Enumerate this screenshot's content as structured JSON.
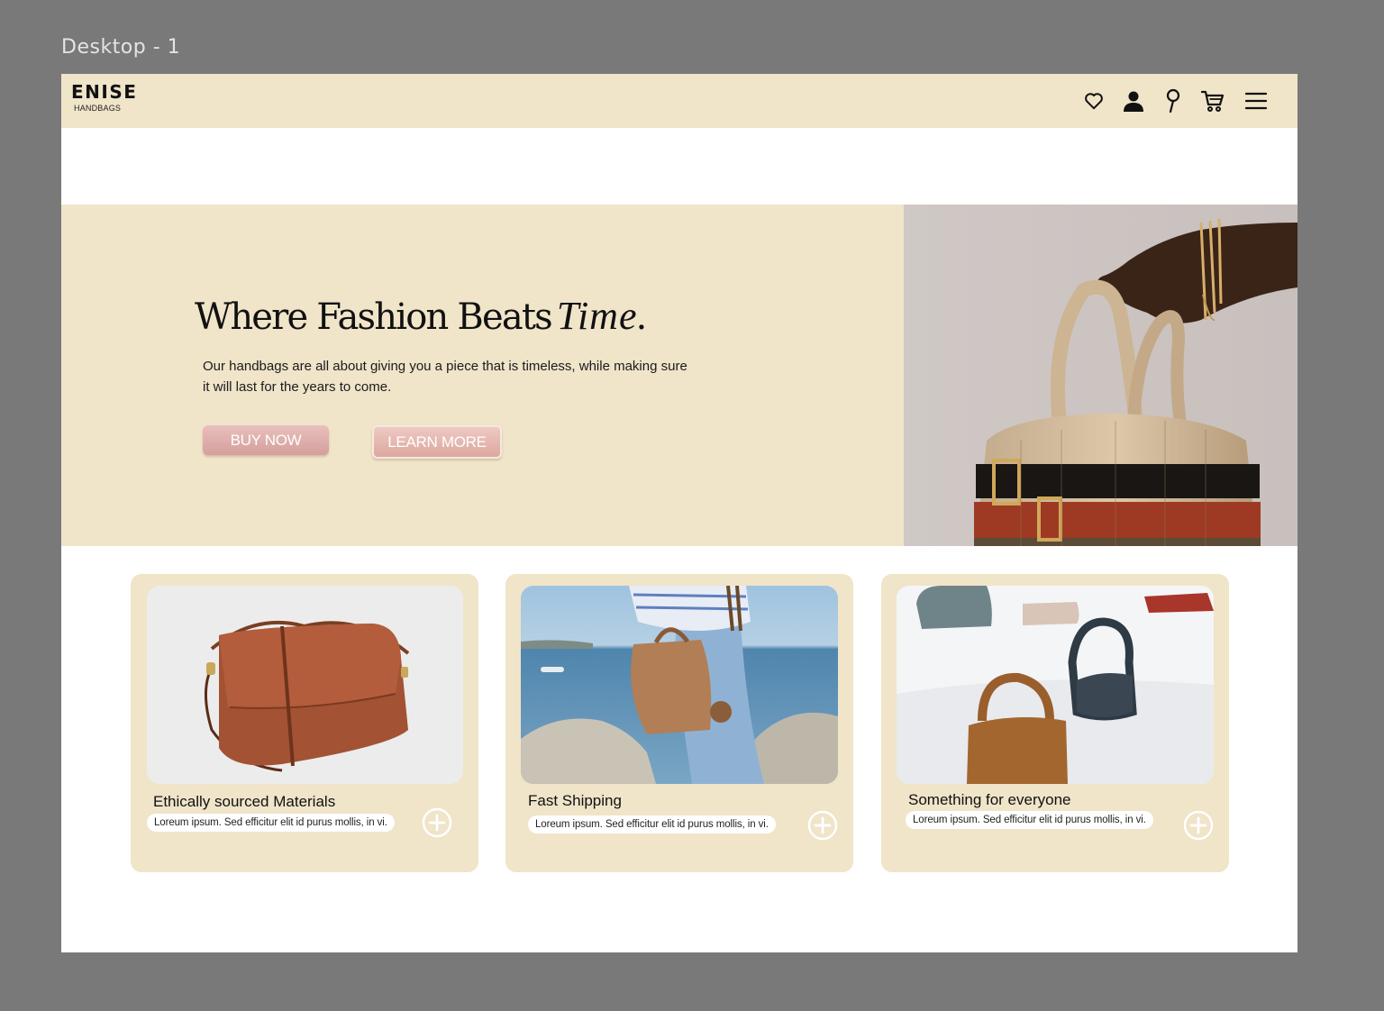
{
  "frame": {
    "label": "Desktop - 1"
  },
  "brand": {
    "name": "ENISE",
    "tagline": "HANDBAGS"
  },
  "nav": {
    "icons": [
      "heart-icon",
      "user-icon",
      "location-pin-icon",
      "cart-icon",
      "menu-icon"
    ]
  },
  "hero": {
    "title": "Where Fashion Beats",
    "title_script": "Time.",
    "text": "Our handbags are all about giving you a piece that is timeless, while making sure it will last for the years to come.",
    "buy_label": "BUY NOW",
    "learn_label": "LEARN MORE"
  },
  "cards": [
    {
      "title": "Ethically sourced Materials",
      "desc": "Loreum ipsum. Sed efficitur elit id purus mollis, in vi."
    },
    {
      "title": "Fast Shipping",
      "desc": "Loreum ipsum. Sed efficitur elit id purus mollis, in vi."
    },
    {
      "title": "Something for everyone",
      "desc": "Loreum ipsum. Sed efficitur elit id purus mollis, in vi."
    }
  ],
  "colors": {
    "cream": "#f0e4c9",
    "button_pink": "#d9a7a4",
    "canvas": "#797979"
  }
}
